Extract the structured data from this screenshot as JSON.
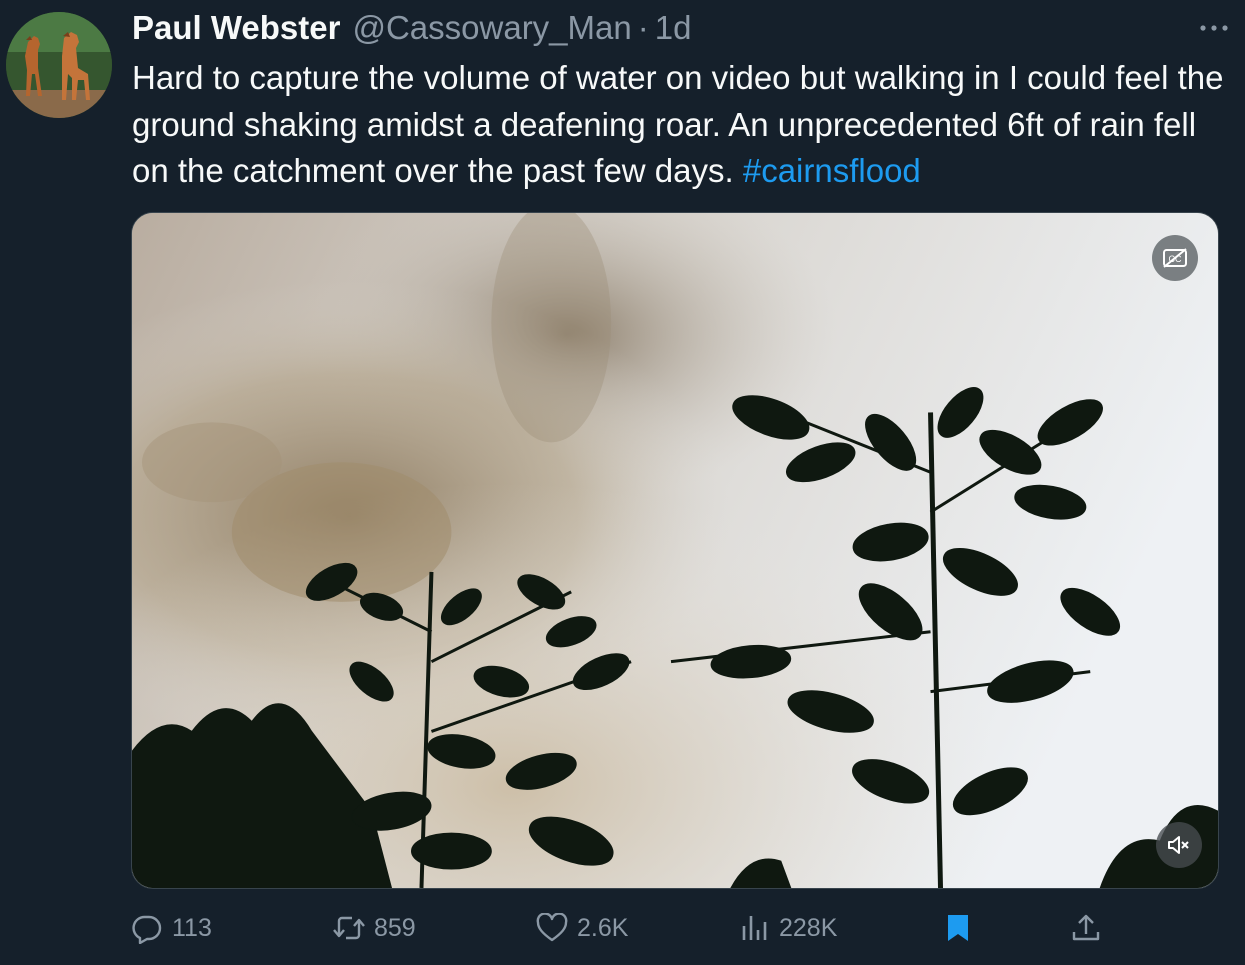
{
  "author": {
    "display_name": "Paul Webster",
    "handle": "@Cassowary_Man",
    "separator": "·",
    "time": "1d"
  },
  "tweet": {
    "text": "Hard to capture the volume of water on video but walking in I could feel the ground shaking amidst a deafening roar. An unprecedented 6ft of rain fell on the catchment over the past few days. ",
    "hashtag": "#cairnsflood"
  },
  "media": {
    "captions_icon": "captions-off-icon",
    "mute_icon": "volume-muted-icon"
  },
  "actions": {
    "replies": "113",
    "reposts": "859",
    "likes": "2.6K",
    "views": "228K"
  },
  "colors": {
    "background": "#15202b",
    "text": "#f7f9f9",
    "secondary": "#8b98a5",
    "accent": "#1d9bf0"
  },
  "icons": [
    "more-icon",
    "reply-icon",
    "repost-icon",
    "like-icon",
    "views-icon",
    "bookmark-icon",
    "share-icon"
  ]
}
